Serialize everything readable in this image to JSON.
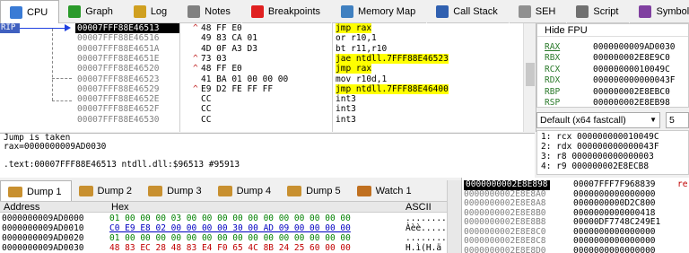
{
  "tabs": [
    {
      "label": "CPU",
      "icon": "cpu-icon",
      "color": "#3a7bd5",
      "active": true
    },
    {
      "label": "Graph",
      "icon": "graph-icon",
      "color": "#2a9a2a"
    },
    {
      "label": "Log",
      "icon": "log-icon",
      "color": "#d0a020"
    },
    {
      "label": "Notes",
      "icon": "notes-icon",
      "color": "#808080"
    },
    {
      "label": "Breakpoints",
      "icon": "breakpoint-icon",
      "color": "#e02020"
    },
    {
      "label": "Memory Map",
      "icon": "memory-map-icon",
      "color": "#4080c0"
    },
    {
      "label": "Call Stack",
      "icon": "call-stack-icon",
      "color": "#3060b0"
    },
    {
      "label": "SEH",
      "icon": "seh-icon",
      "color": "#909090"
    },
    {
      "label": "Script",
      "icon": "script-icon",
      "color": "#707070"
    },
    {
      "label": "Symbols",
      "icon": "symbols-icon",
      "color": "#8040a0"
    }
  ],
  "rip_label": "RIP",
  "disasm": [
    {
      "addr": "00007FFF88E46513",
      "mark": "^",
      "bytes": "48 FF E0",
      "asm": "jmp rax",
      "hl": true,
      "cur": true
    },
    {
      "addr": "00007FFF88E46516",
      "mark": "",
      "bytes": "49 83 CA 01",
      "asm": "or r10,1",
      "hl": false
    },
    {
      "addr": "00007FFF88E4651A",
      "mark": "",
      "bytes": "4D 0F A3 D3",
      "asm": "bt r11,r10",
      "hl": false
    },
    {
      "addr": "00007FFF88E4651E",
      "mark": "^",
      "bytes": "73 03",
      "asm": "jae ntdll.7FFF88E46523",
      "hl": true
    },
    {
      "addr": "00007FFF88E46520",
      "mark": "^",
      "bytes": "48 FF E0",
      "asm": "jmp rax",
      "hl": true
    },
    {
      "addr": "00007FFF88E46523",
      "mark": "",
      "bytes": "41 BA 01 00 00 00",
      "asm": "mov r10d,1",
      "hl": false
    },
    {
      "addr": "00007FFF88E46529",
      "mark": "^",
      "bytes": "E9 D2 FE FF FF",
      "asm": "jmp ntdll.7FFF88E46400",
      "hl": true
    },
    {
      "addr": "00007FFF88E4652E",
      "mark": "",
      "bytes": "CC",
      "asm": "int3",
      "hl": false
    },
    {
      "addr": "00007FFF88E4652F",
      "mark": "",
      "bytes": "CC",
      "asm": "int3",
      "hl": false
    },
    {
      "addr": "00007FFF88E46530",
      "mark": "",
      "bytes": "CC",
      "asm": "int3",
      "hl": false
    }
  ],
  "registers": {
    "header": "Hide FPU",
    "items": [
      {
        "name": "RAX",
        "value": "0000000009AD0030"
      },
      {
        "name": "RBX",
        "value": "000000002E8E9C0"
      },
      {
        "name": "RCX",
        "value": "00000000010049C"
      },
      {
        "name": "RDX",
        "value": "000000000000043F"
      },
      {
        "name": "RBP",
        "value": "000000002E8EBC0"
      },
      {
        "name": "RSP",
        "value": "000000002E8EB98"
      }
    ],
    "name_color": "#2a7a2a"
  },
  "callconv": {
    "selected": "Default (x64 fastcall)",
    "count": "5"
  },
  "args": [
    "1: rcx 000000000010049C",
    "2: rdx 000000000000043F",
    "3: r8 0000000000000003",
    "4: r9 000000002E8ECB8"
  ],
  "info": {
    "line1": "Jump is taken",
    "line2": "rax=0000000009AD0030",
    "line3": "",
    "line4": ".text:00007FFF88E46513 ntdll.dll:$96513 #95913"
  },
  "dump_tabs": [
    {
      "label": "Dump 1",
      "active": true
    },
    {
      "label": "Dump 2"
    },
    {
      "label": "Dump 3"
    },
    {
      "label": "Dump 4"
    },
    {
      "label": "Dump 5"
    },
    {
      "label": "Watch 1"
    }
  ],
  "dump": {
    "headers": {
      "address": "Address",
      "hex": "Hex",
      "ascii": "ASCII"
    },
    "rows": [
      {
        "addr": "0000000009AD0000",
        "hex": "01 00 00 00 03 00 00 00 00 00 00 00 00 00 00 00",
        "ascii": "........"
      },
      {
        "addr": "0000000009AD0010",
        "hex": "C0 E9 E8 02 00 00 00 00 30 00 AD 09 00 00 00 00",
        "ascii": "Àèè....."
      },
      {
        "addr": "0000000009AD0020",
        "hex": "01 00 00 00 00 00 00 00 00 00 00 00 00 00 00 00",
        "ascii": "........"
      },
      {
        "addr": "0000000009AD0030",
        "hex": "48 83 EC 28 48 83 E4 F0 65 4C 8B 24 25 60 00 00",
        "ascii": "H.ì(H.ä"
      }
    ]
  },
  "stack": [
    {
      "addr": "0000000002E8E898",
      "val": "00007FFF7F968839",
      "comment": "re",
      "cur": true
    },
    {
      "addr": "0000000002E8E8A0",
      "val": "0000000000000000"
    },
    {
      "addr": "0000000002E8E8A8",
      "val": "0000000000D2C800"
    },
    {
      "addr": "0000000002E8E8B0",
      "val": "0000000000000418"
    },
    {
      "addr": "0000000002E8E8B8",
      "val": "00000DF7748C249E1"
    },
    {
      "addr": "0000000002E8E8C0",
      "val": "0000000000000000"
    },
    {
      "addr": "0000000002E8E8C8",
      "val": "0000000000000000"
    },
    {
      "addr": "0000000002E8E8D0",
      "val": "0000000000000000"
    }
  ]
}
